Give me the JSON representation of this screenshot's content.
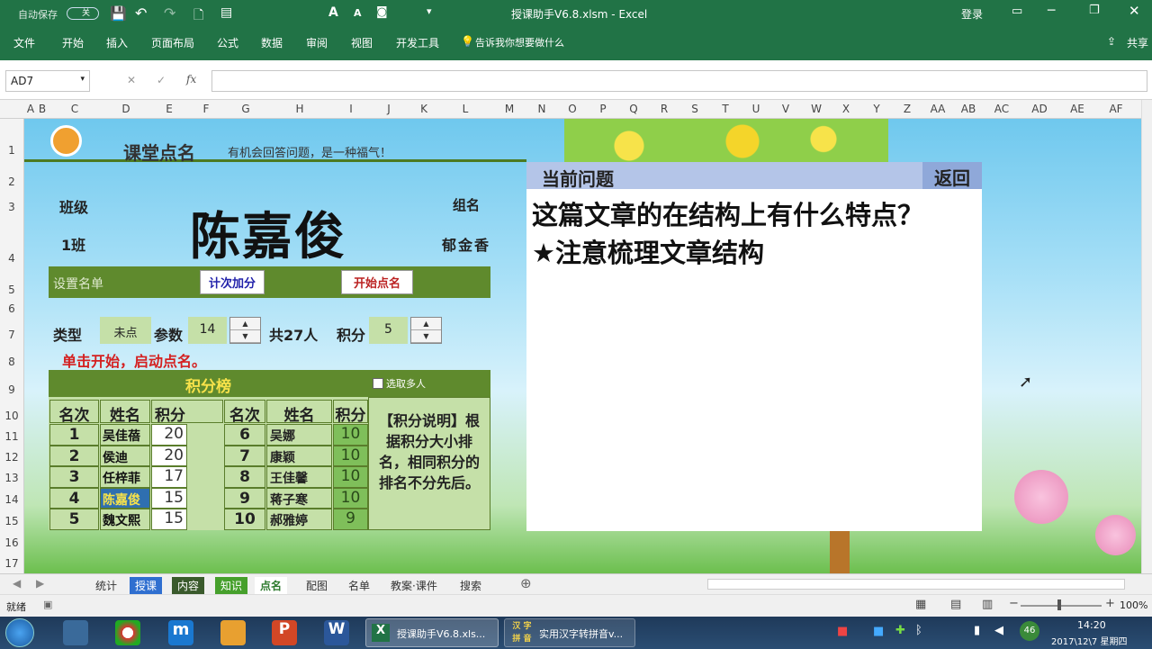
{
  "qat": {
    "autosave": "自动保存",
    "autosave_state": "关",
    "doc_title": "授课助手V6.8.xlsm - Excel",
    "login": "登录"
  },
  "tabs": [
    "文件",
    "开始",
    "插入",
    "页面布局",
    "公式",
    "数据",
    "审阅",
    "视图",
    "开发工具"
  ],
  "tell_me": "告诉我你想要做什么",
  "share": "共享",
  "namebox": "AD7",
  "columns": [
    "A",
    "B",
    "C",
    "D",
    "E",
    "F",
    "G",
    "H",
    "I",
    "J",
    "K",
    "L",
    "M",
    "N",
    "O",
    "P",
    "Q",
    "R",
    "S",
    "T",
    "U",
    "V",
    "W",
    "X",
    "Y",
    "Z",
    "AA",
    "AB",
    "AC",
    "AD",
    "AE",
    "AF"
  ],
  "rows": [
    "1",
    "2",
    "3",
    "4",
    "5",
    "6",
    "7",
    "8",
    "9",
    "10",
    "11",
    "12",
    "13",
    "14",
    "15",
    "16",
    "17"
  ],
  "header": {
    "title": "课堂点名",
    "motto": "有机会回答问题，是一种福气！"
  },
  "student": {
    "class_label": "班级",
    "class_value": "1班",
    "name": "陈嘉俊",
    "group_label": "组名",
    "group_value": "郁金香"
  },
  "actions": {
    "setup_label": "设置名单",
    "count_button": "计次加分",
    "start_button": "开始点名"
  },
  "params": {
    "type_label": "类型",
    "type_value": "未点",
    "param_label": "参数",
    "param_value": "14",
    "total": "共27人",
    "score_label": "积分",
    "score_value": "5"
  },
  "hint": "单击开始，启动点名。",
  "board": {
    "title": "积分榜",
    "multi": "选取多人",
    "h_rank": "名次",
    "h_name": "姓名",
    "h_score": "积分",
    "left": [
      {
        "rank": "1",
        "name": "吴佳蓓",
        "score": "20"
      },
      {
        "rank": "2",
        "name": "侯迪",
        "score": "20"
      },
      {
        "rank": "3",
        "name": "任梓菲",
        "score": "17"
      },
      {
        "rank": "4",
        "name": "陈嘉俊",
        "score": "15"
      },
      {
        "rank": "5",
        "name": "魏文熙",
        "score": "15"
      }
    ],
    "right": [
      {
        "rank": "6",
        "name": "吴娜",
        "score": "10"
      },
      {
        "rank": "7",
        "name": "康颖",
        "score": "10"
      },
      {
        "rank": "8",
        "name": "王佳馨",
        "score": "10"
      },
      {
        "rank": "9",
        "name": "蒋子寒",
        "score": "10"
      },
      {
        "rank": "10",
        "name": "郝雅婷",
        "score": "9"
      }
    ],
    "note": "【积分说明】根据积分大小排名，相同积分的排名不分先后。"
  },
  "question": {
    "header": "当前问题",
    "back": "返回",
    "line1": "这篇文章的在结构上有什么特点？",
    "line2": "★注意梳理文章结构"
  },
  "sheet_tabs": [
    "统计",
    "授课",
    "内容",
    "知识",
    "点名",
    "配图",
    "名单",
    "教案·课件",
    "搜索"
  ],
  "status": {
    "ready": "就绪",
    "zoom": "100%"
  },
  "taskbar": {
    "excel": "授课助手V6.8.xls...",
    "pinyin": "实用汉字转拼音v...",
    "pinyin_logo": "汉 字 拼 音",
    "clock": "14:20",
    "date": "2017\\12\\7 星期四",
    "badge": "46"
  },
  "colors": {
    "ribbon": "#217346",
    "board_green": "#5f8a2d",
    "board_pale": "#c5e0a8"
  }
}
